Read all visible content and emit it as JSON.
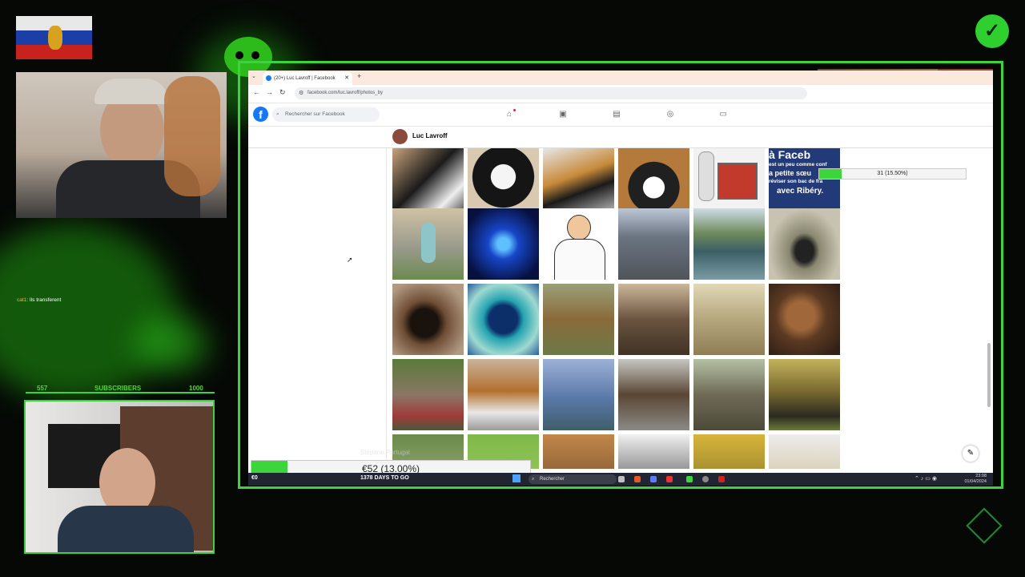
{
  "browser": {
    "tab_title": "(20+) Luc Lavroff | Facebook",
    "new_tab_symbol": "+",
    "url": "facebook.com/luc.lavroff/photos_by",
    "search_placeholder": "Rechercher sur Facebook",
    "profile_name": "Luc Lavroff",
    "meme_text_1": "à Faceb",
    "meme_text_2": "est un peu comme conf",
    "meme_text_3": "a petite sœu",
    "meme_text_4": "réviser son bac de fra",
    "meme_text_5": "avec Ribéry."
  },
  "taskbar": {
    "search_label": "Rechercher",
    "time": "23:08",
    "date": "01/04/2024"
  },
  "overlay": {
    "goal_top_text": "31 (15.50%)",
    "goal_top_percent": 15.5,
    "goal_bottom_text": "€52 (13.00%)",
    "goal_bottom_percent": 13.0,
    "goal_left": "€0",
    "goal_days": "1378 DAYS TO GO",
    "goal_watermark": "Stépane Portugal",
    "subs_left": "557",
    "subs_label": "SUBSCRIBERS",
    "subs_right": "1000",
    "chat_user": "cat1",
    "chat_message": ": Ils transferent"
  },
  "colors": {
    "accent_green": "#3dd33d",
    "facebook_blue": "#1877f2",
    "progress_green": "#3cd63c"
  }
}
